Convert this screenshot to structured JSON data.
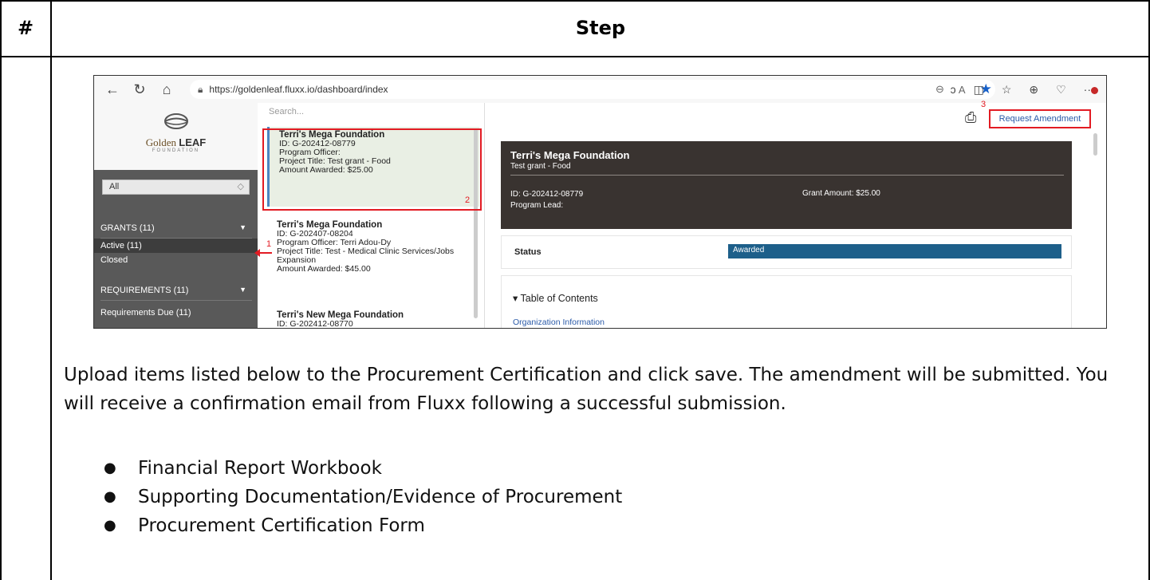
{
  "table": {
    "col_hash": "#",
    "col_step": "Step"
  },
  "screenshot": {
    "url": "https://goldenleaf.fluxx.io/dashboard/index",
    "logo": {
      "name": "Golden",
      "bold": "LEAF",
      "sub": "FOUNDATION"
    },
    "sidebar": {
      "filter_value": "All",
      "grants_header": "GRANTS (11)",
      "active": "Active  (11)",
      "closed": "Closed",
      "requirements_header": "REQUIREMENTS (11)",
      "requirements_due": "Requirements Due  (11)"
    },
    "search_placeholder": "Search...",
    "list": [
      {
        "title": "Terri's Mega Foundation",
        "id": "ID: G-202412-08779",
        "officer": "Program Officer:",
        "project": "Project Title: Test grant - Food",
        "amount": "Amount Awarded: $25.00"
      },
      {
        "title": "Terri's Mega Foundation",
        "id": "ID: G-202407-08204",
        "officer": "Program Officer: Terri Adou-Dy",
        "project": "Project Title: Test - Medical Clinic Services/Jobs Expansion",
        "amount": "Amount Awarded: $45.00"
      },
      {
        "title": "Terri's New Mega Foundation",
        "id": "ID: G-202412-08770"
      }
    ],
    "detail": {
      "request_amendment": "Request Amendment",
      "title": "Terri's Mega Foundation",
      "subtitle": "Test grant - Food",
      "id": "ID: G-202412-08779",
      "program_lead": "Program Lead:",
      "grant_amount": "Grant Amount: $25.00",
      "status_label": "Status",
      "status_value": "Awarded",
      "toc_title": "▾ Table of Contents",
      "toc_first_link": "Organization Information"
    },
    "annotations": [
      "1",
      "2",
      "3"
    ]
  },
  "instructions": "Upload items listed below to the Procurement Certification and click save. The amendment will be submitted. You will receive a confirmation email from Fluxx following a successful submission.",
  "items": [
    "Financial Report Workbook",
    "Supporting Documentation/Evidence of Procurement",
    "Procurement Certification Form"
  ],
  "colors": {
    "annotation": "#e21b23",
    "hero_bg": "#393330",
    "status_bar": "#1d5f8a",
    "sidebar_bg": "#595959",
    "link": "#2a5aa8"
  }
}
